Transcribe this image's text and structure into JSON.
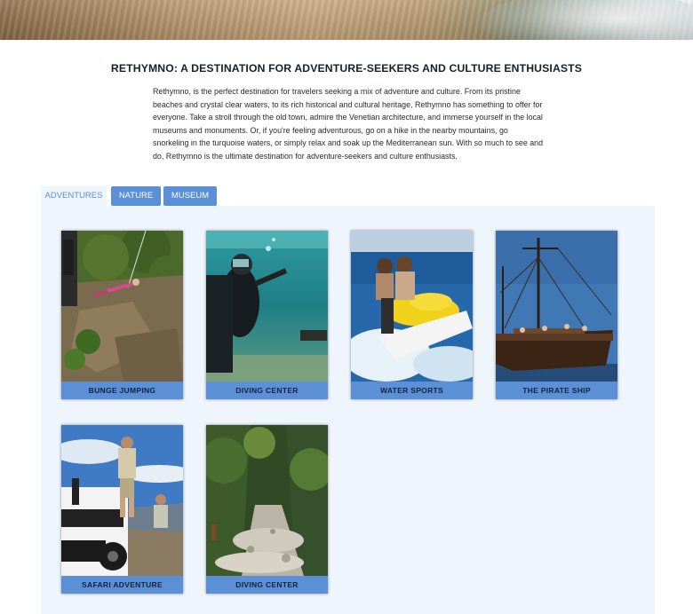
{
  "page": {
    "title": "RETHYMNO: A DESTINATION FOR ADVENTURE-SEEKERS AND CULTURE ENTHUSIASTS",
    "intro": "Rethymno, is the perfect destination for travelers seeking a mix of adventure and culture. From its pristine beaches and crystal clear waters, to its rich historical and cultural heritage, Rethymno has something to offer for everyone. Take a stroll through the old town, admire the Venetian architecture, and immerse yourself in the local museums and monuments. Or, if you're feeling adventurous, go on a hike in the nearby mountains, go snorkeling in the turquoise waters, or simply relax and soak up the Mediterranean sun. With so much to see and do, Rethymno is the ultimate destination for adventure-seekers and culture enthusiasts."
  },
  "tabs": [
    {
      "label": "ADVENTURES",
      "active": true
    },
    {
      "label": "NATURE",
      "active": false
    },
    {
      "label": "MUSEUM",
      "active": false
    }
  ],
  "cards": [
    {
      "label": "BUNGE JUMPING",
      "image": "cliff-climber-photo"
    },
    {
      "label": "DIVING CENTER",
      "image": "scuba-diver-photo"
    },
    {
      "label": "WATER SPORTS",
      "image": "jet-ski-photo"
    },
    {
      "label": "THE PIRATE SHIP",
      "image": "pirate-ship-photo"
    },
    {
      "label": "SAFARI ADVENTURE",
      "image": "safari-jeep-photo"
    },
    {
      "label": "DIVING CENTER",
      "image": "gorge-hike-photo"
    }
  ],
  "colors": {
    "accent": "#5b8fd6",
    "panel": "#eef5fd",
    "title": "#16202f"
  }
}
